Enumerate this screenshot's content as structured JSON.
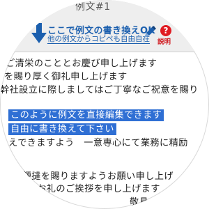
{
  "toolbar": {
    "title_fragment": "例文#1",
    "hint_main": "ここで例文の書き換えOK",
    "hint_sub": "他の例文からコピペも自由自在",
    "help_label": "説明",
    "icons": {
      "arrow": "down-arrow-icon",
      "pencil": "pencil-icon",
      "help": "question-icon"
    },
    "colors": {
      "accent": "#1b5fae",
      "help": "#e01b22"
    }
  },
  "document": {
    "lines": [
      "ご清栄のこととお慶び申し上げます",
      "を賜り厚く御礼申し上げます",
      "幹社設立に際しましてはご丁寧なご祝意を賜り",
      "このように例文を直接編集できます",
      "自由に書き換えて下さい",
      "えできますよう　一意専心にて業務に精励",
      "ご鞭撻を賜りますようお願い申し上げ",
      "てお礼のご挨拶を申し上げます",
      "敬具"
    ],
    "highlight_color": "#2f6fd4"
  }
}
